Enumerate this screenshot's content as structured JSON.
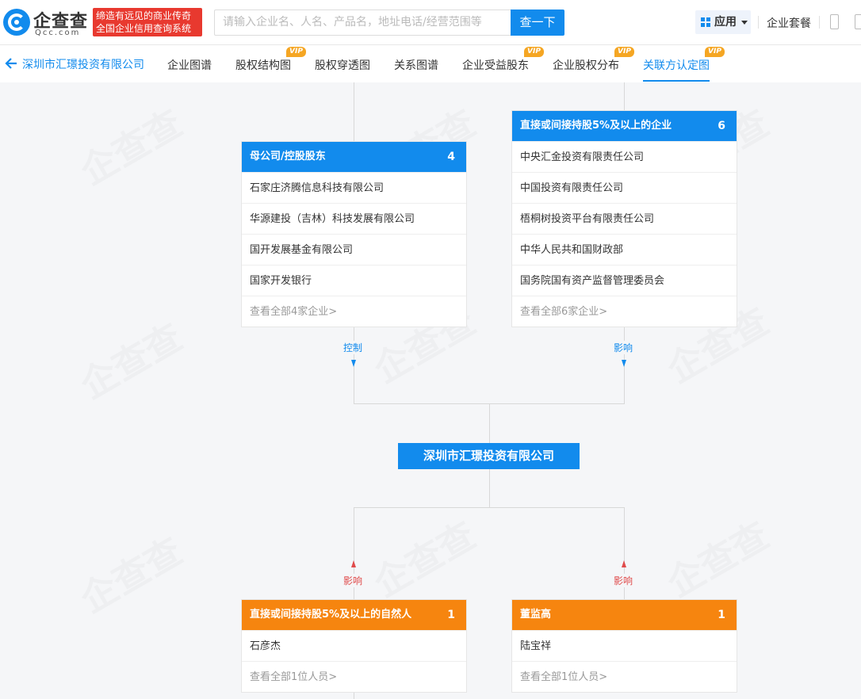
{
  "header": {
    "logo_text": "企查查",
    "logo_sub": "Qcc.com",
    "slogan_line1": "缔造有远见的商业传奇",
    "slogan_line2": "全国企业信用查询系统",
    "search_placeholder": "请输入企业名、人名、产品名，地址电话/经营范围等",
    "search_button": "查一下",
    "apps_label": "应用",
    "package_label": "企业套餐"
  },
  "nav": {
    "back_label": "深圳市汇璟投资有限公司",
    "tabs": [
      {
        "label": "企业图谱",
        "vip": false
      },
      {
        "label": "股权结构图",
        "vip": true
      },
      {
        "label": "股权穿透图",
        "vip": false
      },
      {
        "label": "关系图谱",
        "vip": false
      },
      {
        "label": "企业受益股东",
        "vip": true
      },
      {
        "label": "企业股权分布",
        "vip": true
      },
      {
        "label": "关联方认定图",
        "vip": true,
        "active": true
      }
    ],
    "vip_badge": "VIP"
  },
  "graph": {
    "center_company": "深圳市汇璟投资有限公司",
    "parent": {
      "title": "母公司/控股股东",
      "count": "4",
      "items": [
        "石家庄济腾信息科技有限公司",
        "华源建投（吉林）科技发展有限公司",
        "国开发展基金有限公司",
        "国家开发银行"
      ],
      "more": "查看全部4家企业>"
    },
    "holders5": {
      "title": "直接或间接持股5%及以上的企业",
      "count": "6",
      "items": [
        "中央汇金投资有限责任公司",
        "中国投资有限责任公司",
        "梧桐树投资平台有限责任公司",
        "中华人民共和国财政部",
        "国务院国有资产监督管理委员会"
      ],
      "more": "查看全部6家企业>"
    },
    "persons5": {
      "title": "直接或间接持股5%及以上的自然人",
      "count": "1",
      "items": [
        "石彦杰"
      ],
      "more": "查看全部1位人员>"
    },
    "executives": {
      "title": "董监高",
      "count": "1",
      "items": [
        "陆宝祥"
      ],
      "more": "查看全部1位人员>"
    },
    "edge_labels": {
      "control": "控制",
      "influence_top": "影响",
      "influence_bottom_left": "影响",
      "influence_bottom_right": "影响"
    }
  },
  "colors": {
    "primary": "#128bed",
    "orange": "#f6850f",
    "red_badge": "#e8392f",
    "vip": "#f5a623"
  }
}
